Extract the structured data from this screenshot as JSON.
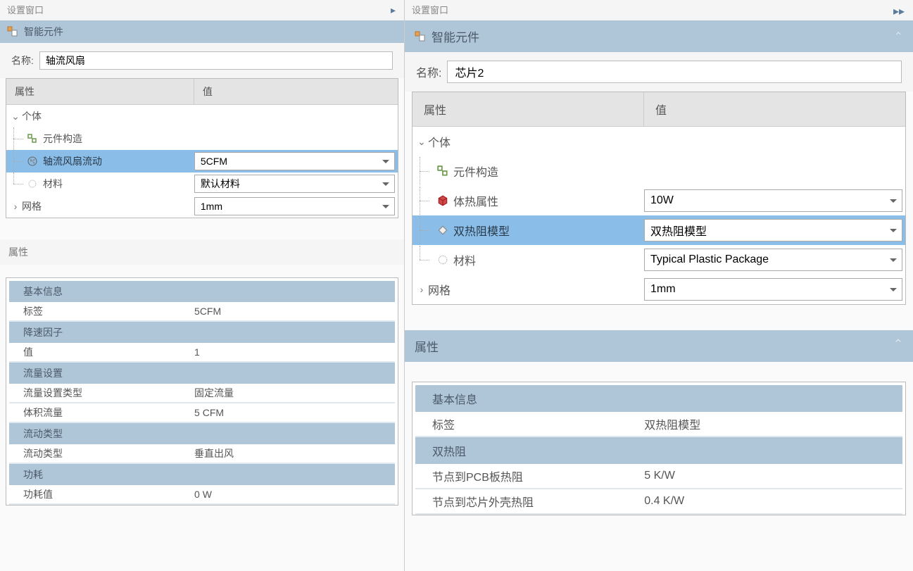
{
  "left": {
    "panelTitle": "设置窗口",
    "section": "智能元件",
    "nameLabel": "名称:",
    "name": "轴流风扇",
    "headers": {
      "prop": "属性",
      "val": "值"
    },
    "tree": {
      "body": "个体",
      "construct": "元件构造",
      "fanFlow": "轴流风扇流动",
      "fanFlowVal": "5CFM",
      "material": "材料",
      "materialVal": "默认材料",
      "mesh": "网格",
      "meshVal": "1mm"
    },
    "propsTitle": "属性",
    "groups": {
      "basic": "基本信息",
      "tag": "标签",
      "tagVal": "5CFM",
      "derate": "降速因子",
      "value": "值",
      "valueVal": "1",
      "flowSet": "流量设置",
      "flowType": "流量设置类型",
      "flowTypeVal": "固定流量",
      "volFlow": "体积流量",
      "volFlowVal": "5 CFM",
      "flowKind": "流动类型",
      "flowKindLabel": "流动类型",
      "flowKindVal": "垂直出风",
      "power": "功耗",
      "powerVal": "功耗值",
      "powerValVal": "0 W"
    }
  },
  "right": {
    "panelTitle": "设置窗口",
    "section": "智能元件",
    "nameLabel": "名称:",
    "name": "芯片2",
    "headers": {
      "prop": "属性",
      "val": "值"
    },
    "tree": {
      "body": "个体",
      "construct": "元件构造",
      "thermal": "体热属性",
      "thermalVal": "10W",
      "twoR": "双热阻模型",
      "twoRVal": "双热阻模型",
      "material": "材料",
      "materialVal": "Typical Plastic Package",
      "mesh": "网格",
      "meshVal": "1mm"
    },
    "propsTitle": "属性",
    "groups": {
      "basic": "基本信息",
      "tag": "标签",
      "tagVal": "双热阻模型",
      "twoR": "双热阻",
      "pcb": "节点到PCB板热阻",
      "pcbVal": "5 K/W",
      "case": "节点到芯片外壳热阻",
      "caseVal": "0.4 K/W"
    }
  }
}
